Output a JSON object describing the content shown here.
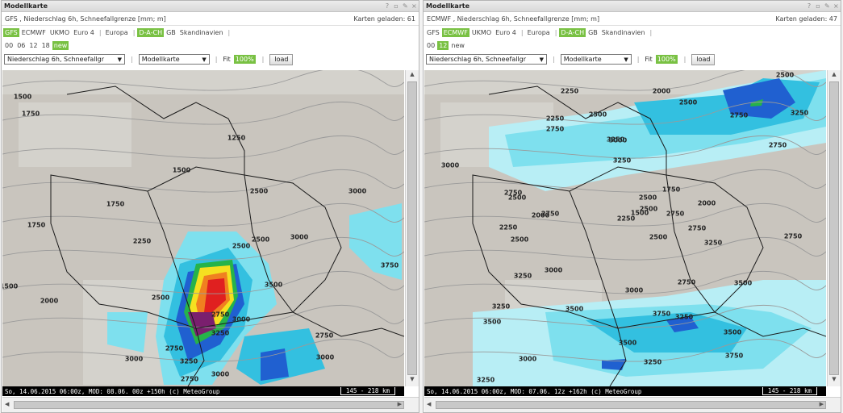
{
  "panels": [
    {
      "title": "Modellkarte",
      "window_controls": [
        "?",
        "▫",
        "✎",
        "×"
      ],
      "description": "GFS , Niederschlag 6h, Schneefallgrenze [mm; m]",
      "maps_loaded": "Karten geladen: 61",
      "models": [
        {
          "label": "GFS",
          "active": true
        },
        {
          "label": "ECMWF",
          "active": false
        },
        {
          "label": "UKMO",
          "active": false
        },
        {
          "label": "Euro 4",
          "active": false
        }
      ],
      "regions": [
        {
          "label": "Europa",
          "active": false
        },
        {
          "label": "D-A-CH",
          "active": true
        },
        {
          "label": "GB",
          "active": false
        },
        {
          "label": "Skandinavien",
          "active": false
        }
      ],
      "runs": [
        {
          "label": "00",
          "active": false
        },
        {
          "label": "06",
          "active": false
        },
        {
          "label": "12",
          "active": false
        },
        {
          "label": "18",
          "active": false
        },
        {
          "label": "new",
          "active": true
        }
      ],
      "parameter_select": "Niederschlag 6h, Schneefallgr",
      "map_type_select": "Modellkarte",
      "fit_label": "Fit",
      "fit_value": "100%",
      "load_button": "load",
      "status": "So, 14.06.2015 06:00z, MOD: 08.06. 00z +150h (c) MeteoGroup",
      "scale": "145 - 218 km",
      "isolines": [
        "1500",
        "1750",
        "1250",
        "1500",
        "1750",
        "2500",
        "3000",
        "2250",
        "1750",
        "1500",
        "2000",
        "2500",
        "3000",
        "3750",
        "3500",
        "2500",
        "2500",
        "2750",
        "3000",
        "2750",
        "3000",
        "3250",
        "3000",
        "2750",
        "3250",
        "2750",
        "3000"
      ]
    },
    {
      "title": "Modellkarte",
      "window_controls": [
        "?",
        "▫",
        "✎",
        "×"
      ],
      "description": "ECMWF , Niederschlag 6h, Schneefallgrenze [mm; m]",
      "maps_loaded": "Karten geladen: 47",
      "models": [
        {
          "label": "GFS",
          "active": false
        },
        {
          "label": "ECMWF",
          "active": true
        },
        {
          "label": "UKMO",
          "active": false
        },
        {
          "label": "Euro 4",
          "active": false
        }
      ],
      "regions": [
        {
          "label": "Europa",
          "active": false
        },
        {
          "label": "D-A-CH",
          "active": true
        },
        {
          "label": "GB",
          "active": false
        },
        {
          "label": "Skandinavien",
          "active": false
        }
      ],
      "runs": [
        {
          "label": "00",
          "active": false
        },
        {
          "label": "12",
          "active": true
        },
        {
          "label": "new",
          "active": false
        }
      ],
      "parameter_select": "Niederschlag 6h, Schneefallgr",
      "map_type_select": "Modellkarte",
      "fit_label": "Fit",
      "fit_value": "100%",
      "load_button": "load",
      "status": "So, 14.06.2015 06:00z, MOD: 07.06. 12z +162h (c) MeteoGroup",
      "scale": "145 - 218 km",
      "isolines": [
        "2500",
        "2250",
        "2000",
        "2500",
        "2250",
        "2500",
        "2750",
        "3250",
        "2750",
        "3250",
        "2750",
        "3000",
        "3000",
        "3250",
        "2750",
        "2500",
        "1750",
        "2000",
        "2500",
        "1500",
        "2750",
        "2250",
        "2500",
        "2750",
        "2000",
        "2250",
        "2500",
        "2750",
        "2500",
        "3250",
        "2750",
        "3000",
        "3250",
        "2750",
        "3000",
        "3500",
        "3250",
        "3500",
        "3250",
        "3750",
        "3500",
        "3500",
        "3750",
        "3500",
        "3250",
        "3000",
        "3250"
      ]
    }
  ]
}
